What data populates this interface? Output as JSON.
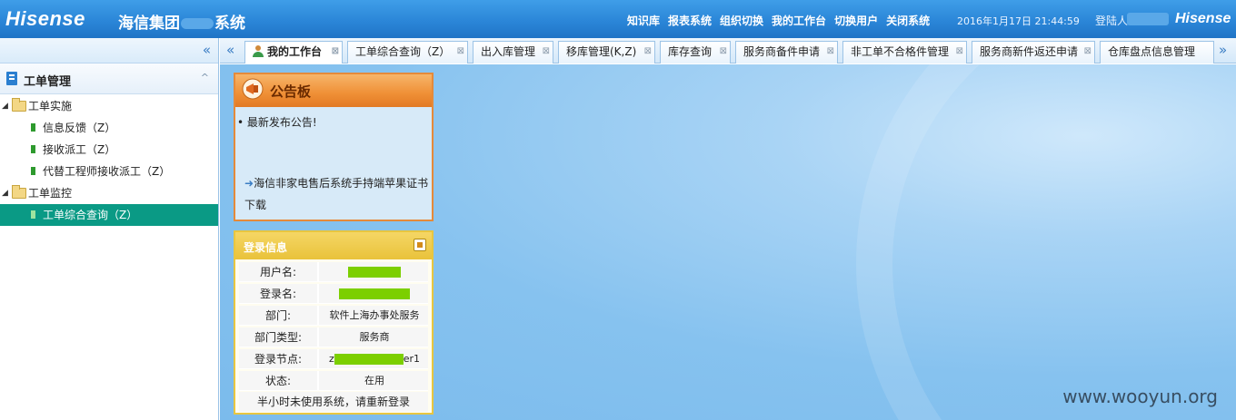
{
  "header": {
    "brand": "Hisense",
    "company_name_pre": "海信集团",
    "company_name_post": "系统",
    "nav": [
      "知识库",
      "报表系统",
      "组织切换",
      "我的工作台",
      "切换用户",
      "关闭系统"
    ],
    "datetime": "2016年1月17日 21:44:59",
    "login_label": "登陆人:",
    "brand_right": "Hisense"
  },
  "sidebar": {
    "collapse_icon": "«",
    "panel_title": "工单管理",
    "panel_toggle_icon": "^",
    "tree": {
      "group1": "工单实施",
      "group1_items": [
        "信息反馈（Z）",
        "接收派工（Z）",
        "代替工程师接收派工（Z）"
      ],
      "group2": "工单监控",
      "group2_items": [
        "工单综合查询（Z）"
      ]
    }
  },
  "tabs": {
    "scroll_left": "«",
    "scroll_right": "»",
    "items": [
      "我的工作台",
      "工单综合查询（Z）",
      "出入库管理",
      "移库管理(K,Z)",
      "库存查询",
      "服务商备件申请",
      "非工单不合格件管理",
      "服务商新件返还申请",
      "仓库盘点信息管理"
    ],
    "close_glyph": "⊠"
  },
  "bulletin": {
    "title": "公告板",
    "item1": "• 最新发布公告!",
    "item2": "海信非家电售后系统手持端苹果证书下载"
  },
  "login_info": {
    "title": "登录信息",
    "rows": [
      {
        "label": "用户名:",
        "value": ""
      },
      {
        "label": "登录名:",
        "value": ""
      },
      {
        "label": "部门:",
        "value": "软件上海办事处服务"
      },
      {
        "label": "部门类型:",
        "value": "服务商"
      },
      {
        "label": "登录节点:",
        "value_pre": "z",
        "value_post": "er1"
      },
      {
        "label": "状态:",
        "value": "在用"
      }
    ],
    "footer": "半小时未使用系统，请重新登录"
  },
  "watermark": "www.wooyun.org",
  "colors": {
    "header_blue": "#2b86d8",
    "selected_teal": "#0a9a85",
    "bulletin_orange": "#ef8f35",
    "login_yellow": "#e9c23a",
    "censor_green": "#7ccf00"
  }
}
